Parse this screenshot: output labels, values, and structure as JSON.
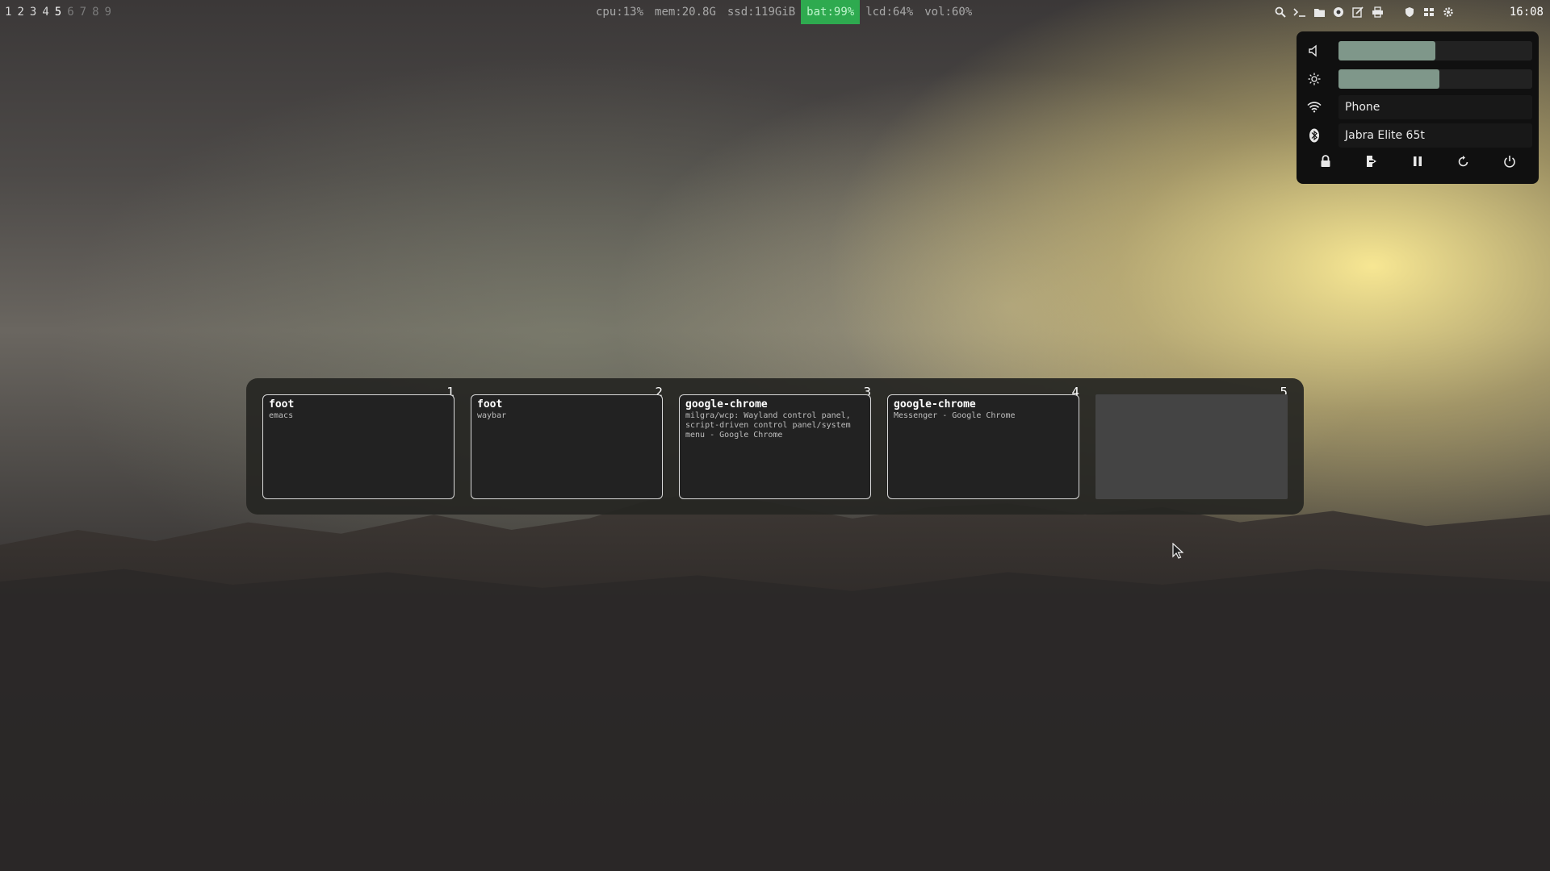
{
  "workspaces": [
    {
      "label": "1",
      "state": "occupied"
    },
    {
      "label": "2",
      "state": "occupied"
    },
    {
      "label": "3",
      "state": "occupied"
    },
    {
      "label": "4",
      "state": "occupied"
    },
    {
      "label": "5",
      "state": "active"
    },
    {
      "label": "6",
      "state": "empty"
    },
    {
      "label": "7",
      "state": "empty"
    },
    {
      "label": "8",
      "state": "empty"
    },
    {
      "label": "9",
      "state": "empty"
    }
  ],
  "stats": {
    "cpu": "cpu:13%",
    "mem": "mem:20.8G",
    "ssd": "ssd:119GiB",
    "bat": "bat:99%",
    "lcd": "lcd:64%",
    "vol": "vol:60%"
  },
  "tray_icons": [
    "search-icon",
    "terminal-icon",
    "folder-icon",
    "chrome-icon",
    "edit-icon",
    "printer-icon",
    "shield-icon",
    "grid-icon",
    "gear-icon"
  ],
  "clock": "16:08",
  "control_panel": {
    "volume_level": 0.5,
    "brightness_level": 0.52,
    "wifi_label": "Phone",
    "bluetooth_label": "Jabra Elite 65t",
    "actions": [
      "lock-icon",
      "logout-icon",
      "pause-icon",
      "restart-icon",
      "power-icon"
    ],
    "slider_fill_color": "#7f978a"
  },
  "overview": {
    "workspaces": [
      {
        "number": "1",
        "app": "foot",
        "title": "emacs"
      },
      {
        "number": "2",
        "app": "foot",
        "title": "waybar"
      },
      {
        "number": "3",
        "app": "google-chrome",
        "title": "milgra/wcp: Wayland control panel,\nscript-driven control panel/system\nmenu - Google Chrome"
      },
      {
        "number": "4",
        "app": "google-chrome",
        "title": "Messenger - Google Chrome"
      },
      {
        "number": "5",
        "app": "",
        "title": ""
      }
    ]
  },
  "colors": {
    "battery_bg": "#2eaa4f",
    "panel_bg": "#101010"
  }
}
